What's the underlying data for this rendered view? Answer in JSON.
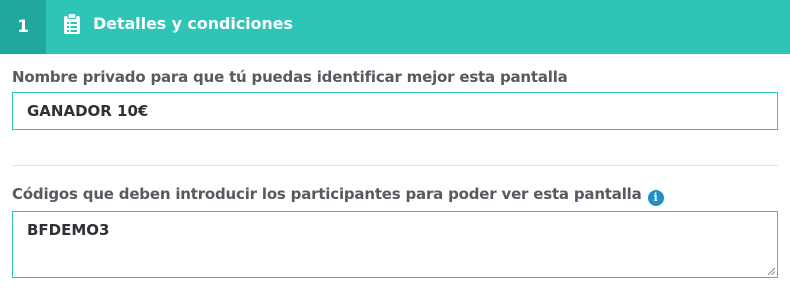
{
  "header": {
    "step_number": "1",
    "icon": "clipboard-icon",
    "title": "Detalles y condiciones",
    "accent_color": "#2ec4b6"
  },
  "form": {
    "private_name": {
      "label": "Nombre privado para que tú puedas identificar mejor esta pantalla",
      "value": "GANADOR 10€"
    },
    "access_codes": {
      "label": "Códigos que deben introducir los participantes para poder ver esta pantalla",
      "info_icon": "info-icon",
      "value": "BFDEMO3"
    }
  }
}
